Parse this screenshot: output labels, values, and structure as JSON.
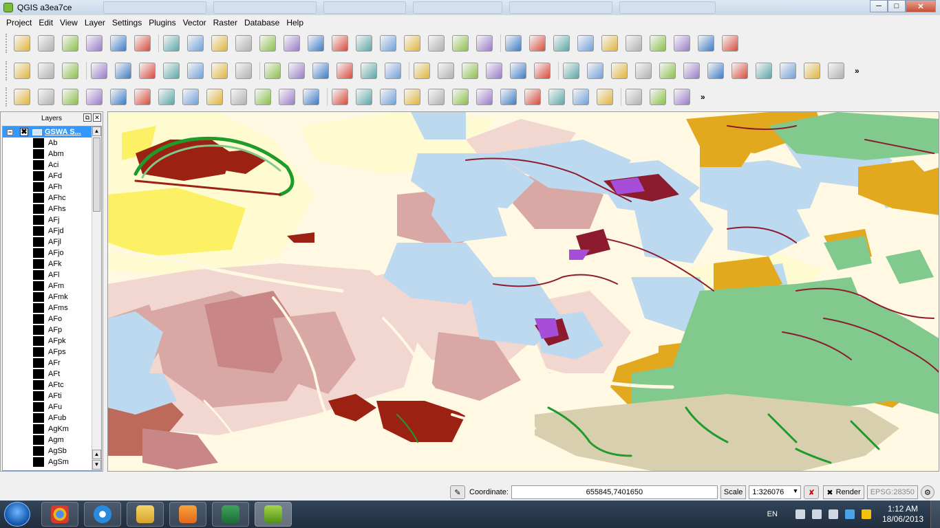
{
  "window": {
    "title": "QGIS a3ea7ce",
    "buttons": {
      "minimize": "─",
      "maximize": "□",
      "close": "✕"
    }
  },
  "menu": [
    "Project",
    "Edit",
    "View",
    "Layer",
    "Settings",
    "Plugins",
    "Vector",
    "Raster",
    "Database",
    "Help"
  ],
  "toolbar1": {
    "icons": [
      "new-project-icon",
      "open-project-icon",
      "save-project-icon",
      "save-as-icon",
      "new-print-composer-icon",
      "composer-manager-icon",
      "add-vector-layer-icon",
      "add-raster-layer-icon",
      "add-postgis-layer-icon",
      "add-spatialite-layer-icon",
      "add-mssql-layer-icon",
      "add-oracle-layer-icon",
      "add-wms-layer-icon",
      "add-wcs-layer-icon",
      "add-wfs-layer-icon",
      "add-delimited-text-icon",
      "new-shapefile-icon",
      "remove-layer-icon",
      "new-spatialite-layer-icon",
      "add-sql-anywhere-icon",
      "toggle-editing-icon",
      "current-edits-icon",
      "save-edits-icon",
      "add-feature-icon",
      "move-feature-icon",
      "node-tool-icon",
      "delete-selected-icon",
      "cut-features-icon",
      "copy-features-icon",
      "paste-features-icon"
    ]
  },
  "toolbar2": {
    "icons": [
      "copy-style-icon",
      "paste-style-icon",
      "grass-tools-icon",
      "digitize-icon",
      "editing-icon",
      "node-icon",
      "add-ring-icon",
      "simplify-icon",
      "rotate-icon",
      "offset-icon",
      "label-tool-icon",
      "label-pin-icon",
      "label-show-icon",
      "label-move-icon",
      "label-rotate-icon",
      "label-change-icon",
      "histogram-icon",
      "stretch-icon",
      "raster-stats-icon",
      "rotate-point-icon",
      "sun-icon",
      "shade-icon",
      "gps-icon",
      "globe-icon",
      "grid-icon",
      "raster-calc-icon",
      "pan-map-icon",
      "pan-to-selection-icon",
      "zoom-in-icon",
      "zoom-out-icon",
      "zoom-actual-icon",
      "zoom-full-icon",
      "zoom-layer-icon",
      "zoom-selection-icon"
    ],
    "overflow": "»"
  },
  "toolbar3": {
    "icons": [
      "undo-icon",
      "redo-icon",
      "add-part-icon",
      "fill-ring-icon",
      "delete-ring-icon",
      "delete-part-icon",
      "reshape-icon",
      "offset-curve-icon",
      "split-features-icon",
      "split-parts-icon",
      "merge-selected-icon",
      "merge-attributes-icon",
      "rotate-symbols-icon",
      "identify-icon",
      "run-action-icon",
      "select-features-icon",
      "deselect-icon",
      "field-calculator-icon",
      "attribute-table-icon",
      "statistics-icon",
      "measure-icon",
      "map-tips-icon",
      "new-bookmark-icon",
      "show-bookmarks-icon",
      "text-annotation-icon",
      "gps-info-icon",
      "plugin-icon",
      "python-icon"
    ],
    "overflow": "»"
  },
  "layers_panel": {
    "title": "Layers",
    "float_glyph": "⧉",
    "close_glyph": "✕",
    "group": {
      "expand": "−",
      "checked": "✖",
      "name": "GSWA S..."
    },
    "items": [
      "Ab",
      "Abm",
      "Aci",
      "AFd",
      "AFh",
      "AFhc",
      "AFhs",
      "AFj",
      "AFjd",
      "AFjl",
      "AFjo",
      "AFk",
      "AFl",
      "AFm",
      "AFmk",
      "AFms",
      "AFo",
      "AFp",
      "AFpk",
      "AFps",
      "AFr",
      "AFt",
      "AFtc",
      "AFti",
      "AFu",
      "AFub",
      "AgKm",
      "Agm",
      "AgSb",
      "AgSm"
    ],
    "scroll_up": "▲",
    "scroll_down": "▼",
    "symbol_color": "#000000"
  },
  "map_colors": {
    "background": "#fff8e2",
    "cream": "#fffbd0",
    "yellow": "#fcf064",
    "pink": "#f2d6d0",
    "rose": "#d9a8a4",
    "mauve": "#c88786",
    "rust": "#bd6a5a",
    "blue": "#bcd9f0",
    "darkred": "#9b2112",
    "maroon": "#8c1b2e",
    "orange": "#e2a81e",
    "green": "#82c98e",
    "darkgreen": "#1f9b2b",
    "khaki": "#d8cfae",
    "purple": "#a64ed8"
  },
  "status": {
    "coordinate_label": "Coordinate:",
    "coordinate_value": "655845,7401650",
    "scale_label": "Scale",
    "scale_value": "1:326076",
    "render_check": "✖",
    "render_label": "Render",
    "crs": "EPSG:28350"
  },
  "taskbar": {
    "apps": [
      "chrome-icon",
      "internet-explorer-icon",
      "file-explorer-icon",
      "media-player-icon",
      "excel-icon",
      "qgis-icon"
    ],
    "language": "EN",
    "time": "1:12 AM",
    "date": "18/06/2013"
  }
}
